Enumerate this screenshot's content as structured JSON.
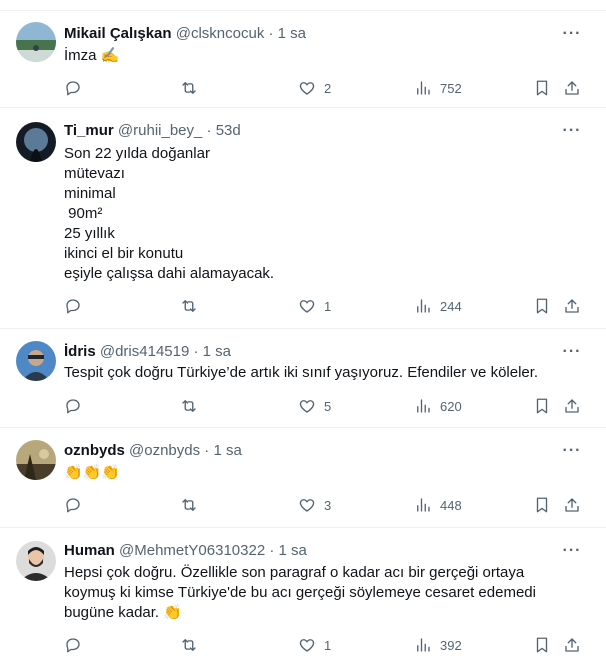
{
  "tweets": [
    {
      "name": "Mikail Çalışkan",
      "handle": "@clskncocuk",
      "time": "1 sa",
      "text": "İmza ✍️",
      "likes": "2",
      "views": "752",
      "avatar_colors": [
        "#7ea9c9",
        "#3f6b45",
        "#c9d6d9"
      ]
    },
    {
      "name": "Ti_mur",
      "handle": "@ruhii_bey_",
      "time": "53d",
      "text": "Son 22 yılda doğanlar\nmütevazı\nminimal\n 90m²\n25 yıllık\nikinci el bir konutu\neşiyle çalışsa dahi alamayacak.",
      "likes": "1",
      "views": "244",
      "avatar_colors": [
        "#1b2430",
        "#6f8da8",
        "#0d1117"
      ]
    },
    {
      "name": "İdris",
      "handle": "@dris414519",
      "time": "1 sa",
      "text": "Tespit çok doğru Türkiye’de artık iki sınıf yaşıyoruz. Efendiler ve köleler.",
      "likes": "5",
      "views": "620",
      "avatar_colors": [
        "#4f88c6",
        "#c9a88a",
        "#2a3a4a"
      ]
    },
    {
      "name": "oznbyds",
      "handle": "@oznbyds",
      "time": "1 sa",
      "text": "👏👏👏",
      "likes": "3",
      "views": "448",
      "avatar_colors": [
        "#8a7a55",
        "#4a3e2a",
        "#c9b48a"
      ]
    },
    {
      "name": "Human",
      "handle": "@MehmetY06310322",
      "time": "1 sa",
      "text": "Hepsi çok doğru. Özellikle son paragraf o kadar acı bir gerçeği ortaya\nkoymuş ki kimse Türkiye'de bu acı gerçeği söylemeye cesaret edemedi\nbugüne kadar. 👏",
      "likes": "1",
      "views": "392",
      "avatar_colors": [
        "#d8d8d8",
        "#2b2b2b",
        "#e9c6a9"
      ]
    }
  ],
  "dot": "·",
  "icons": {
    "more": "more-horizontal-icon",
    "reply": "reply-icon",
    "retweet": "retweet-icon",
    "like": "heart-icon",
    "views": "views-bar-chart-icon",
    "bookmark": "bookmark-icon",
    "share": "share-icon"
  },
  "colors": {
    "text": "#0f1419",
    "secondary": "#536471",
    "divider": "#eff3f4",
    "background": "#ffffff"
  }
}
